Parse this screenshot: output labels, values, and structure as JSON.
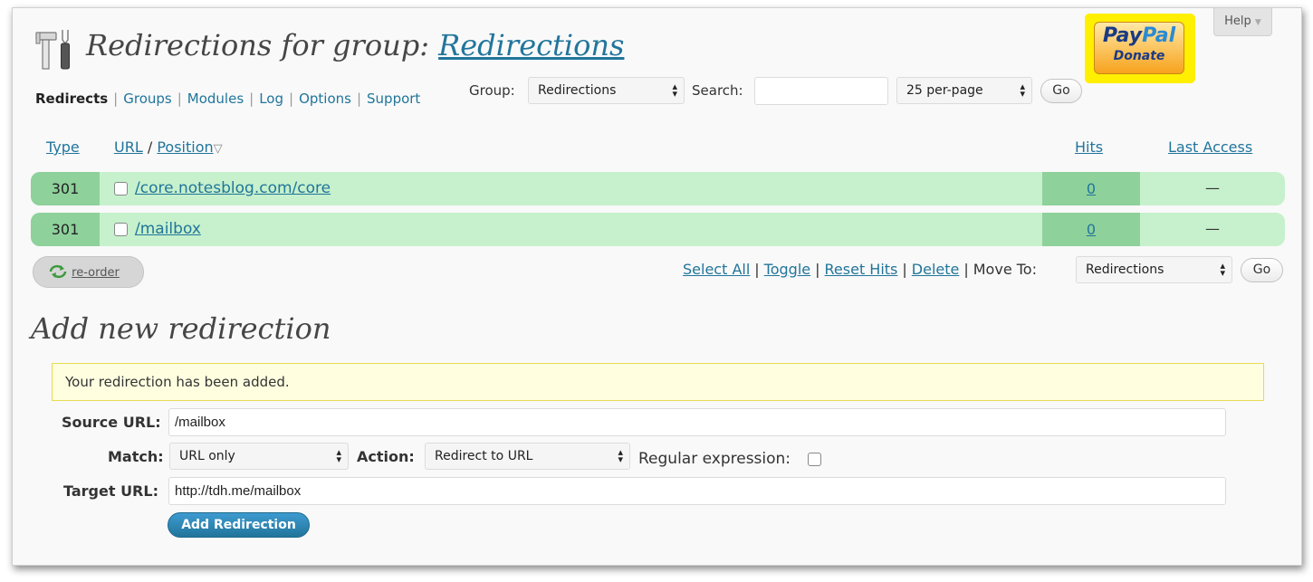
{
  "header": {
    "title_prefix": "Redirections for group:",
    "title_group_link": "Redirections",
    "help_label": "Help",
    "help_arrow": "▼"
  },
  "paypal": {
    "brand_pay": "Pay",
    "brand_pal": "Pal",
    "donate": "Donate"
  },
  "nav": {
    "items": [
      "Redirects",
      "Groups",
      "Modules",
      "Log",
      "Options",
      "Support"
    ],
    "separator": "|"
  },
  "filter": {
    "group_label": "Group:",
    "group_value": "Redirections",
    "search_label": "Search:",
    "search_value": "",
    "per_page_value": "25 per-page",
    "go_label": "Go"
  },
  "table": {
    "columns": {
      "type": "Type",
      "url": "URL",
      "slash": "/",
      "position": "Position",
      "hits": "Hits",
      "last_access": "Last Access"
    },
    "rows": [
      {
        "type": "301",
        "url": "/core.notesblog.com/core",
        "hits": "0",
        "last_access": "—"
      },
      {
        "type": "301",
        "url": "/mailbox",
        "hits": "0",
        "last_access": "—"
      }
    ]
  },
  "bulk": {
    "reorder_label": "re-order",
    "select_all": "Select All",
    "toggle": "Toggle",
    "reset_hits": "Reset Hits",
    "delete": "Delete",
    "move_to_label": "Move To:",
    "move_to_value": "Redirections",
    "go_label": "Go",
    "separator": "|"
  },
  "add_form": {
    "heading": "Add new redirection",
    "notice": "Your redirection has been added.",
    "source_label": "Source URL:",
    "source_value": "/mailbox",
    "match_label": "Match:",
    "match_value": "URL only",
    "action_label": "Action:",
    "action_value": "Redirect to URL",
    "regex_label": "Regular expression:",
    "target_label": "Target URL:",
    "target_value": "http://tdh.me/mailbox",
    "submit_label": "Add Redirection"
  },
  "colors": {
    "link": "#21759b",
    "row_bg": "#c6f1cc",
    "row_accent": "#8ed19b",
    "notice_bg": "#ffffe0",
    "paypal_yellow": "#ffef00"
  }
}
